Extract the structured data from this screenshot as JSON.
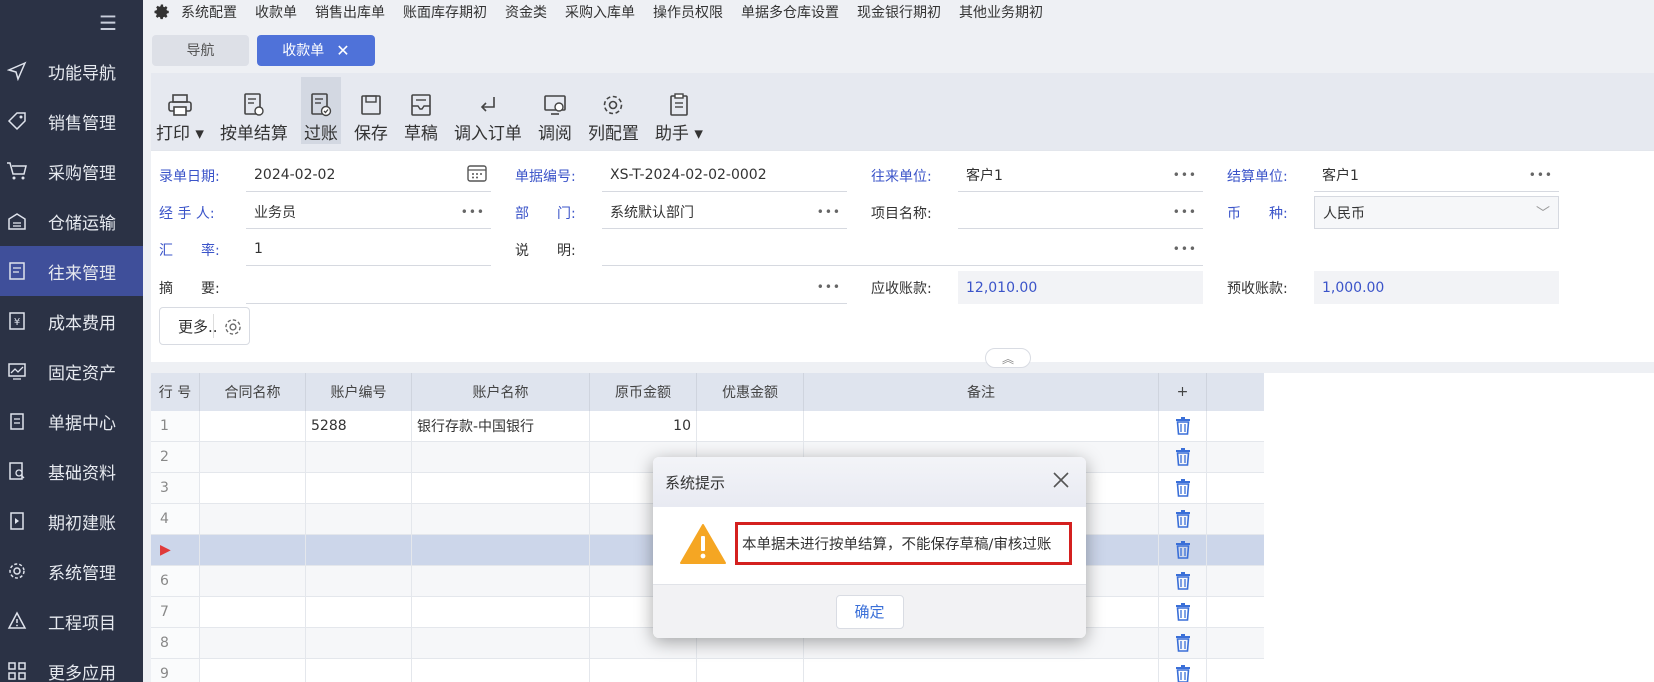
{
  "sidebar": {
    "items": [
      {
        "label": "功能导航",
        "icon": "send-icon"
      },
      {
        "label": "销售管理",
        "icon": "tag-icon"
      },
      {
        "label": "采购管理",
        "icon": "cart-icon"
      },
      {
        "label": "仓储运输",
        "icon": "warehouse-icon"
      },
      {
        "label": "往来管理",
        "icon": "ledger-icon"
      },
      {
        "label": "成本费用",
        "icon": "yen-icon"
      },
      {
        "label": "固定资产",
        "icon": "chart-icon"
      },
      {
        "label": "单据中心",
        "icon": "clipboard-icon"
      },
      {
        "label": "基础资料",
        "icon": "document-search-icon"
      },
      {
        "label": "期初建账",
        "icon": "book-icon"
      },
      {
        "label": "系统管理",
        "icon": "settings-icon"
      },
      {
        "label": "工程项目",
        "icon": "warning-icon"
      },
      {
        "label": "更多应用",
        "icon": "grid-icon"
      }
    ]
  },
  "topmenu": {
    "items": [
      "系统配置",
      "收款单",
      "销售出库单",
      "账面库存期初",
      "资金类",
      "采购入库单",
      "操作员权限",
      "单据多仓库设置",
      "现金银行期初",
      "其他业务期初"
    ]
  },
  "tabs": {
    "nav": "导航",
    "active": "收款单",
    "close": "✕"
  },
  "toolbar": {
    "print": "打印 ▾",
    "settle": "按单结算",
    "post": "过账",
    "save": "保存",
    "draft": "草稿",
    "import": "调入订单",
    "review": "调阅",
    "columns": "列配置",
    "helper": "助手 ▾"
  },
  "form": {
    "date_label": "录单日期:",
    "date_value": "2024-02-02",
    "docno_label": "单据编号:",
    "docno_value": "XS-T-2024-02-02-0002",
    "partner_label": "往来单位:",
    "partner_value": "客户1",
    "settle_label": "结算单位:",
    "settle_value": "客户1",
    "handler_label": "经 手 人:",
    "handler_value": "业务员",
    "dept_label": "部　　门:",
    "dept_value": "系统默认部门",
    "project_label": "项目名称:",
    "project_value": "",
    "currency_label": "币　　种:",
    "currency_value": "人民币",
    "rate_label": "汇　　率:",
    "rate_value": "1",
    "desc_label": "说　　明:",
    "desc_value": "",
    "summary_label": "摘　　要:",
    "summary_value": "",
    "receivable_label": "应收账款:",
    "receivable_value": "12,010.00",
    "prepaid_label": "预收账款:",
    "prepaid_value": "1,000.00",
    "more": "更多..",
    "dots": "•••"
  },
  "grid": {
    "headers": [
      "行 号",
      "合同名称",
      "账户编号",
      "账户名称",
      "原币金额",
      "优惠金额",
      "备注",
      "+"
    ],
    "rows": [
      {
        "no": "1",
        "contract": "",
        "acct_no": "5288",
        "acct_name": "银行存款-中国银行",
        "amount": "10",
        "discount": "",
        "note": ""
      },
      {
        "no": "2",
        "contract": "",
        "acct_no": "",
        "acct_name": "",
        "amount": "",
        "discount": "",
        "note": ""
      },
      {
        "no": "3",
        "contract": "",
        "acct_no": "",
        "acct_name": "",
        "amount": "",
        "discount": "",
        "note": ""
      },
      {
        "no": "4",
        "contract": "",
        "acct_no": "",
        "acct_name": "",
        "amount": "",
        "discount": "",
        "note": ""
      },
      {
        "no": "▶",
        "contract": "",
        "acct_no": "",
        "acct_name": "",
        "amount": "",
        "discount": "",
        "note": ""
      },
      {
        "no": "6",
        "contract": "",
        "acct_no": "",
        "acct_name": "",
        "amount": "",
        "discount": "",
        "note": ""
      },
      {
        "no": "7",
        "contract": "",
        "acct_no": "",
        "acct_name": "",
        "amount": "",
        "discount": "",
        "note": ""
      },
      {
        "no": "8",
        "contract": "",
        "acct_no": "",
        "acct_name": "",
        "amount": "",
        "discount": "",
        "note": ""
      },
      {
        "no": "9",
        "contract": "",
        "acct_no": "",
        "acct_name": "",
        "amount": "",
        "discount": "",
        "note": ""
      }
    ]
  },
  "dialog": {
    "title": "系统提示",
    "message": "本单据未进行按单结算，不能保存草稿/审核过账",
    "ok": "确定"
  },
  "colors": {
    "sidebar_bg": "#2b3245",
    "sidebar_active": "#3f4f9a",
    "tab_active": "#4f72d9",
    "label_blue": "#3b54c9",
    "highlight_red": "#d4201f",
    "warning_orange": "#f5a623",
    "trash_blue": "#3a6fd8"
  }
}
